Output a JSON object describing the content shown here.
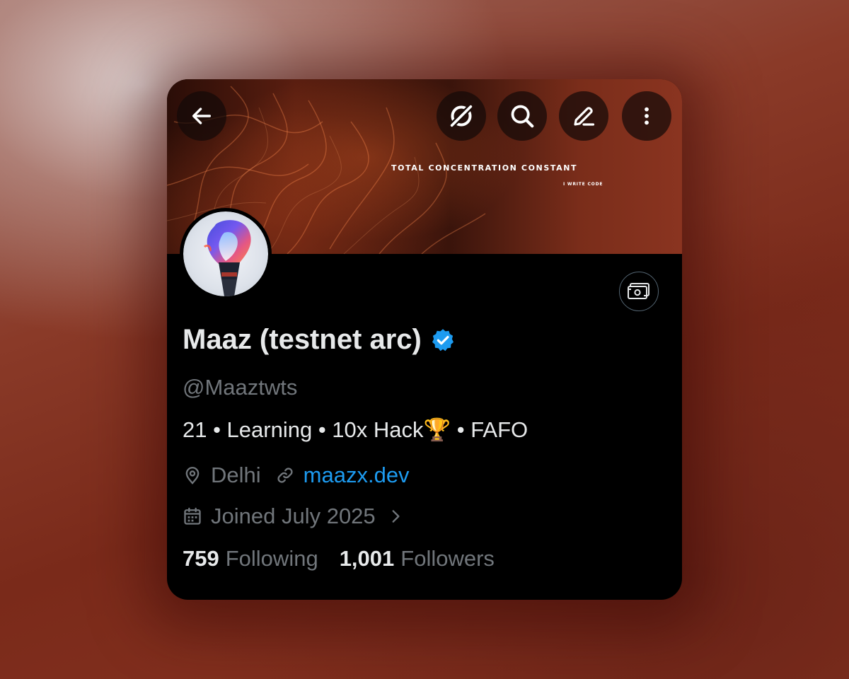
{
  "banner": {
    "title": "TOTAL CONCENTRATION CONSTANT",
    "subtitle": "I WRITE CODE"
  },
  "toolbar": {
    "back_icon": "arrow-left-icon",
    "grok_icon": "grok-icon",
    "search_icon": "search-icon",
    "edit_icon": "pencil-icon",
    "more_icon": "more-vertical-icon"
  },
  "profile": {
    "display_name": "Maaz (testnet arc)",
    "verified": true,
    "handle": "@Maaztwts",
    "bio": "21 • Learning • 10x Hack🏆 • FAFO",
    "location": "Delhi",
    "website": "maazx.dev",
    "joined": "Joined July 2025",
    "following_count": "759",
    "following_label": "Following",
    "followers_count": "1,001",
    "followers_label": "Followers"
  },
  "colors": {
    "link": "#1d9bf0",
    "verified_badge": "#1d9bf0",
    "muted_text": "#71767b",
    "primary_text": "#e7e9ea"
  }
}
